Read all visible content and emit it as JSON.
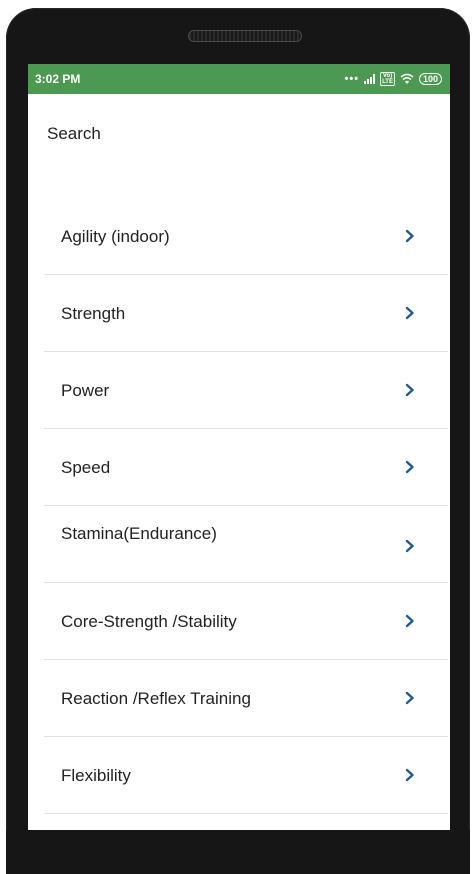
{
  "status_bar": {
    "time": "3:02 PM",
    "dots": "•••",
    "volte_top": "Vo)",
    "volte_bottom": "LTE",
    "battery": "100"
  },
  "search": {
    "label": "Search"
  },
  "categories": [
    {
      "label": "Agility (indoor)"
    },
    {
      "label": "Strength"
    },
    {
      "label": "Power"
    },
    {
      "label": "Speed"
    },
    {
      "label": "Stamina(Endurance)"
    },
    {
      "label": "Core-Strength /Stability"
    },
    {
      "label": "Reaction /Reflex Training"
    },
    {
      "label": "Flexibility"
    }
  ],
  "colors": {
    "status_bar": "#4c9a52",
    "chevron": "#1f5a96",
    "divider": "#e2e2e2",
    "phone_body": "#161616"
  }
}
